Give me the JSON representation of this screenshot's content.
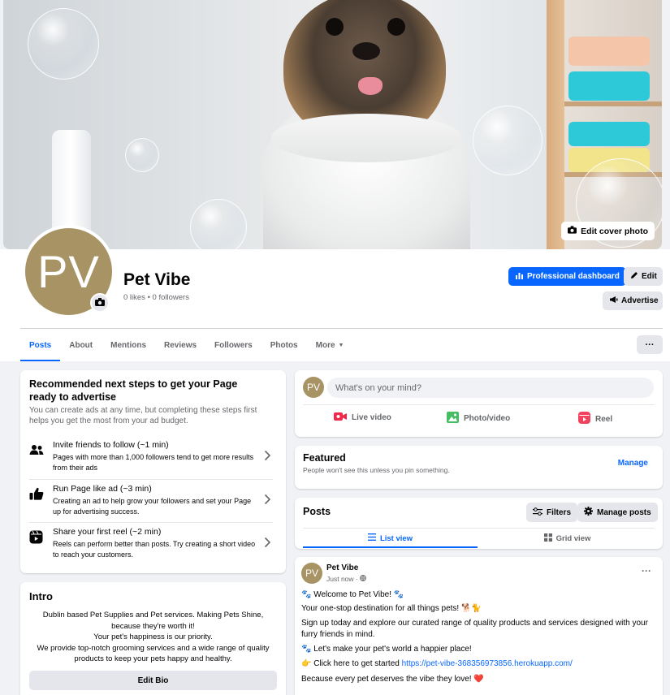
{
  "cover": {
    "edit_label": "Edit cover photo"
  },
  "profile": {
    "initials": "PV",
    "name": "Pet Vibe",
    "stats": "0 likes • 0 followers"
  },
  "actions": {
    "dashboard": "Professional dashboard",
    "edit": "Edit",
    "advertise": "Advertise"
  },
  "tabs": [
    "Posts",
    "About",
    "Mentions",
    "Reviews",
    "Followers",
    "Photos",
    "More"
  ],
  "recommended": {
    "title": "Recommended next steps to get your Page ready to advertise",
    "subtitle": "You can create ads at any time, but completing these steps first helps you get the most from your ad budget.",
    "steps": [
      {
        "title": "Invite friends to follow (~1 min)",
        "desc": "Pages with more than 1,000 followers tend to get more results from their ads",
        "icon": "friends-icon"
      },
      {
        "title": "Run Page like ad (~3 min)",
        "desc": "Creating an ad to help grow your followers and set your Page up for advertising success.",
        "icon": "thumbs-up-icon"
      },
      {
        "title": "Share your first reel (~2 min)",
        "desc": "Reels can perform better than posts. Try creating a short video to reach your customers.",
        "icon": "reels-icon"
      }
    ]
  },
  "intro": {
    "title": "Intro",
    "lines": [
      "Dublin based Pet Supplies and Pet services. Making Pets Shine,",
      "because they're worth it!",
      "Your pet's happiness is our priority.",
      "We provide top-notch grooming services and a wide range of quality",
      "products to keep your pets happy and healthy."
    ],
    "edit_bio": "Edit Bio"
  },
  "composer": {
    "placeholder": "What's on your mind?",
    "live": "Live video",
    "photo": "Photo/video",
    "reel": "Reel"
  },
  "featured": {
    "title": "Featured",
    "subtitle": "People won't see this unless you pin something.",
    "manage": "Manage"
  },
  "posts_section": {
    "title": "Posts",
    "filters": "Filters",
    "manage": "Manage posts",
    "list_view": "List view",
    "grid_view": "Grid view"
  },
  "post": {
    "author": "Pet Vibe",
    "time": "Just now ·",
    "lines": [
      "🐾 Welcome to Pet Vibe! 🐾",
      "Your one-stop destination for all things pets! 🐕🐈",
      "Sign up today and explore our curated range of quality products and services designed with your furry friends in mind.",
      "🐾 Let's make your pet's world a happier place!",
      "👉 Click here to get started ",
      "Because every pet deserves the vibe they love! ❤️"
    ],
    "link": "https://pet-vibe-368356973856.herokuapp.com/"
  },
  "colors": {
    "accent": "#0866ff",
    "avatar": "#a89364",
    "background": "#f0f2f5"
  }
}
